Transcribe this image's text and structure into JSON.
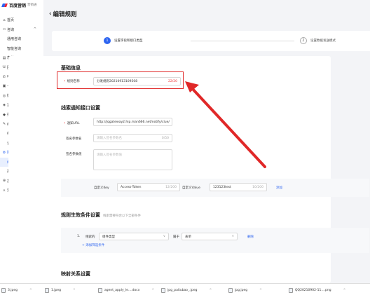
{
  "app": {
    "brand": "百度营销",
    "brand_sub": "营销通"
  },
  "sidebar": {
    "items": [
      {
        "label": "首页",
        "icon": "home-icon",
        "glyph": "⌂",
        "type": "item"
      },
      {
        "label": "咨询",
        "icon": "chat-icon",
        "glyph": "▭",
        "type": "group",
        "arrow": "^"
      },
      {
        "label": "通用咨询",
        "type": "sub"
      },
      {
        "label": "智能咨询",
        "type": "sub"
      },
      {
        "label": "表单",
        "icon": "form-icon",
        "glyph": "▤",
        "type": "item"
      },
      {
        "label": "回呼",
        "icon": "callback-icon",
        "glyph": "☏",
        "type": "item"
      },
      {
        "label": "电话",
        "icon": "phone-icon",
        "glyph": "✆",
        "type": "item"
      },
      {
        "label": "卡券",
        "icon": "coupon-icon",
        "glyph": "▣",
        "type": "item"
      },
      {
        "label": "微信",
        "icon": "wechat-icon",
        "glyph": "◎",
        "type": "item"
      },
      {
        "label": "百家号",
        "icon": "baijiahao-icon",
        "glyph": "◈",
        "type": "item"
      },
      {
        "label": "抽奖",
        "icon": "lottery-icon",
        "glyph": "◆",
        "type": "item"
      },
      {
        "label": "线索管理",
        "icon": "leads-icon",
        "glyph": "✎",
        "type": "group",
        "arrow": "^"
      },
      {
        "label": "线索详单",
        "type": "sub"
      },
      {
        "label": "咨询转化过滤",
        "type": "sub"
      },
      {
        "label": "账户设置",
        "icon": "settings-icon",
        "glyph": "⚙",
        "type": "group-active",
        "arrow": "^"
      },
      {
        "label": "线索接收",
        "type": "sub-active"
      },
      {
        "label": "报表权限",
        "type": "sub"
      },
      {
        "label": "基木鱼",
        "icon": "fish-icon",
        "glyph": "⊕",
        "type": "item"
      },
      {
        "label": "爱番番",
        "icon": "aifanfan-icon",
        "glyph": "⋏",
        "type": "item"
      }
    ]
  },
  "page": {
    "back": "‹",
    "title": "编辑规则"
  },
  "steps": [
    {
      "num": "1",
      "label": "设置字段和接口类型"
    },
    {
      "num": "2",
      "label": "设置数据发送模式"
    }
  ],
  "basic": {
    "title": "基础信息",
    "rule_name_label": "规则名称",
    "rule_name_value": "分发规则20210913109508",
    "rule_name_count": "22/20"
  },
  "api": {
    "title": "线索通知接口设置",
    "url_label": "通知URL",
    "url_value": "http://jqgateway2.hip.man666.net/notify/clue/",
    "sign_name_label": "签名参数名",
    "sign_name_placeholder": "请输入签名参数名",
    "sign_name_count": "0/50",
    "sign_value_label": "签名参数值",
    "sign_value_placeholder": "请输入签名参数值",
    "header_label": "自定义Header",
    "key_label": "自定义Key",
    "key_value": "Access-Token",
    "key_count": "12/200",
    "val_label": "自定义Value",
    "val_value": "123123test",
    "val_count": "10/200",
    "add": "添加"
  },
  "rule": {
    "title": "规则生效条件设置",
    "note": "线索需要符合以下全部条件",
    "cond_label": "规则生效条件",
    "cond_num": "1.",
    "cond_prefix": "线索的",
    "field_select": "组件类型",
    "relation": "属于",
    "value_select": "表单",
    "delete": "删除",
    "add_filter": "+ 添加筛选条件"
  },
  "mapping": {
    "title": "映射关系设置"
  },
  "taskbar": {
    "items": [
      {
        "label": "3.jpeg"
      },
      {
        "label": "1.jpeg"
      },
      {
        "label": "agent_apply_le....docx"
      },
      {
        "label": "jpg_paitubao_.jpeg"
      },
      {
        "label": "jpg.jpeg"
      },
      {
        "label": "QQ20210902-11....png"
      }
    ]
  },
  "colors": {
    "accent": "#2d64f0",
    "alert": "#e02828",
    "background": "#f3f4f7"
  }
}
